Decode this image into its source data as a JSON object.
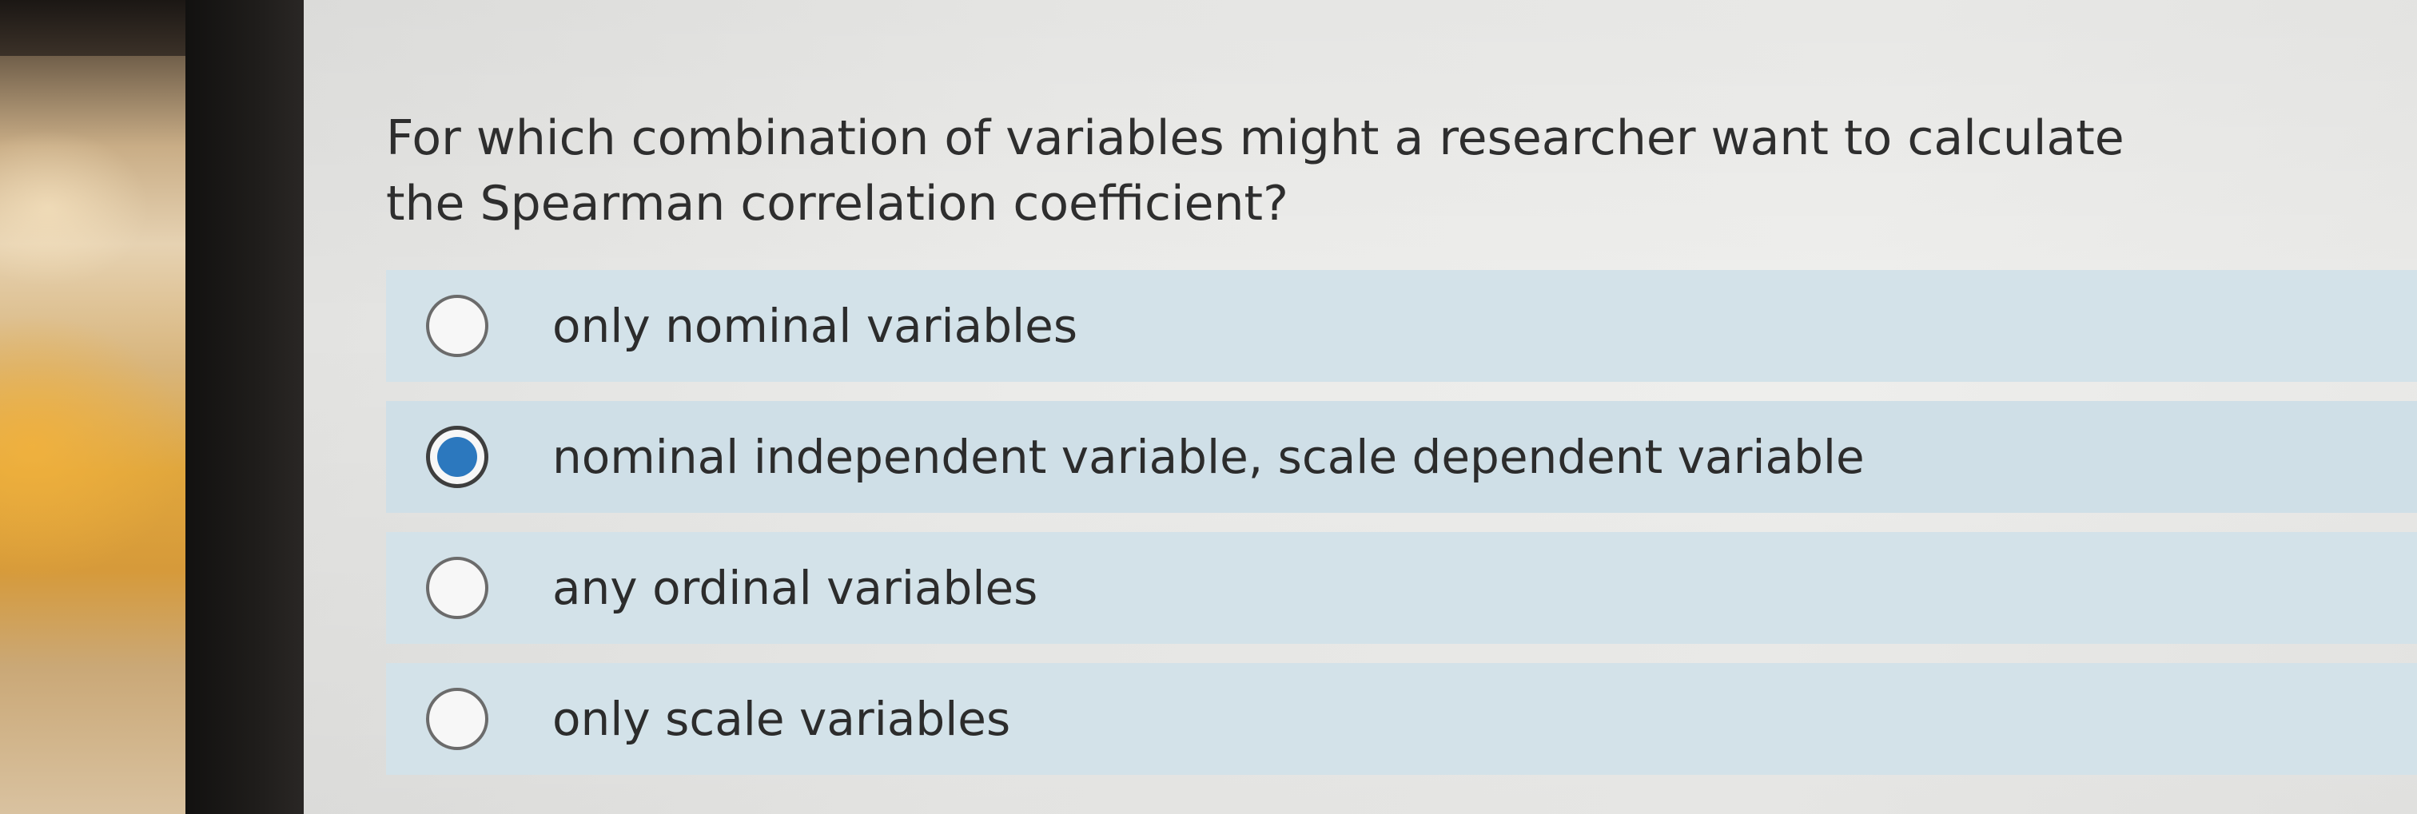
{
  "quiz": {
    "question": "For which combination of variables might a researcher want to calculate the Spearman correlation coefficient?",
    "options": [
      {
        "label": "only nominal variables",
        "selected": false
      },
      {
        "label": "nominal independent variable, scale dependent variable",
        "selected": true
      },
      {
        "label": "any ordinal variables",
        "selected": false
      },
      {
        "label": "only scale variables",
        "selected": false
      }
    ]
  },
  "colors": {
    "option_background": "#d3e2e9",
    "selected_radio_fill": "#2c78be",
    "text": "#2e2e2e"
  },
  "icons": {
    "radio_unchecked": "radio-unchecked-icon",
    "radio_checked": "radio-checked-icon"
  }
}
